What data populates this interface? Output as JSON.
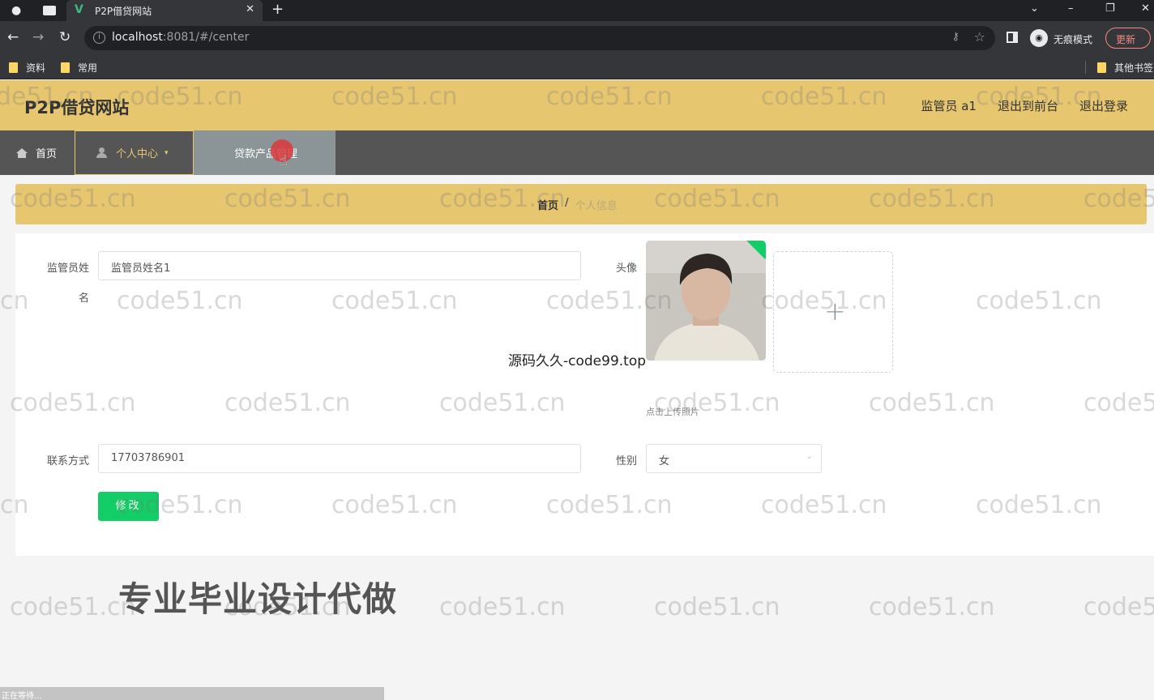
{
  "browser": {
    "tab_title": "P2P借贷网站",
    "tab_favicon": "V",
    "url_host": "localhost",
    "url_rest": ":8081/#/center",
    "incognito_label": "无痕模式",
    "update_label": "更新",
    "bookmarks": [
      "资料",
      "常用"
    ],
    "other_bookmarks": "其他书签"
  },
  "app": {
    "brand": "P2P借贷网站",
    "header_links": [
      "监管员 a1",
      "退出到前台",
      "退出登录"
    ],
    "nav": {
      "home": "首页",
      "center": "个人中心",
      "loan": "贷款产品管理"
    },
    "breadcrumb": {
      "home": "首页",
      "separator": "/",
      "current": "个人信息"
    }
  },
  "form": {
    "name_label_1": "监管员姓",
    "name_label_2": "名",
    "name_value": "监管员姓名1",
    "avatar_label": "头像",
    "upload_tip": "点击上传照片",
    "contact_label": "联系方式",
    "contact_value": "17703786901",
    "gender_label": "性别",
    "gender_value": "女",
    "submit_label": "修改"
  },
  "overlays": {
    "watermark": "code51.cn",
    "code99": "源码久久-code99.top",
    "promo": "专业毕业设计代做",
    "bottom_strip": "正在等待..."
  }
}
